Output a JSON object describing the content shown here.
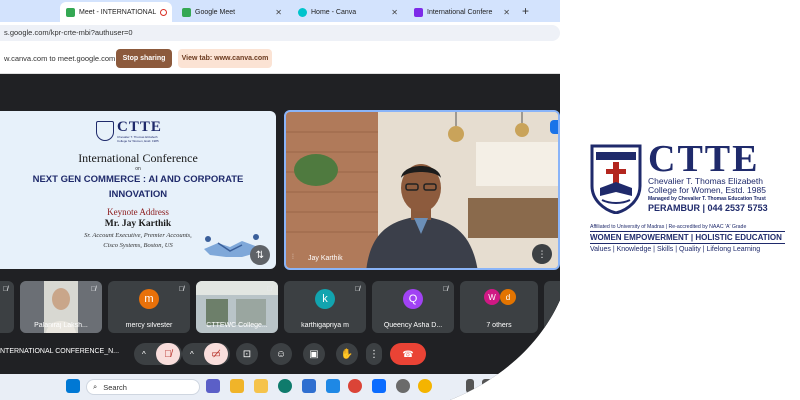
{
  "browser": {
    "tabs": [
      {
        "label": "Meet - INTERNATIONAL",
        "active": true
      },
      {
        "label": "Google Meet"
      },
      {
        "label": "Home - Canva"
      },
      {
        "label": "International Confere"
      }
    ],
    "new_tab": "+",
    "url": "s.google.com/kpr-crte-mbi?authuser=0"
  },
  "sharebar": {
    "message": "w.canva.com to meet.google.com",
    "stop_label": "Stop sharing",
    "view_label": "View tab: www.canva.com"
  },
  "slide": {
    "logo_name": "CTTE",
    "logo_sub": "Chevalier T. Thomas Elizabeth College for Women, Estd. 1985",
    "conference": "International Conference",
    "on": "on",
    "theme_line1": "NEXT GEN COMMERCE : AI AND CORPORATE",
    "theme_line2": "INNOVATION",
    "keynote": "Keynote Address",
    "speaker": "Mr. Jay Karthik",
    "role_line1": "Sr. Account Executive, Premier Accounts,",
    "role_line2": "Cisco Systems, Boston, US"
  },
  "video": {
    "name": "Jay Karthik"
  },
  "participants": [
    {
      "name": "Palaniraj Laksh..."
    },
    {
      "name": "mercy silvester",
      "initial": "m",
      "color": "#e8710a"
    },
    {
      "name": "CTTEWC College..."
    },
    {
      "name": "karthigapriya m",
      "initial": "k",
      "color": "#12a4af"
    },
    {
      "name": "Queency Asha D...",
      "initial": "Q",
      "color": "#a142f4"
    },
    {
      "name": "7 others",
      "initials": [
        "W",
        "d"
      ]
    }
  ],
  "meeting_title": "NTERNATIONAL CONFERENCE_N...",
  "taskbar": {
    "search_placeholder": "Search"
  },
  "right_logo": {
    "name": "CTTE",
    "college_line1": "Chevalier T. Thomas Elizabeth",
    "college_line2": "College for Women, Estd. 1985",
    "managed_by": "Managed by Chevalier T. Thomas Education Trust",
    "address": "PERAMBUR | 044 2537 5753",
    "affiliation": "Affiliated to University of Madras | Re-accredited by NAAC 'A' Grade",
    "motto": "WOMEN EMPOWERMENT | HOLISTIC EDUCATION",
    "values": "Values | Knowledge | Skills | Quality | Lifelong Learning"
  },
  "colors": {
    "brand_navy": "#1f2a6b",
    "stop_sharing": "#8c5a3c",
    "leave_call": "#ea4335",
    "meet_bg": "#202124"
  }
}
